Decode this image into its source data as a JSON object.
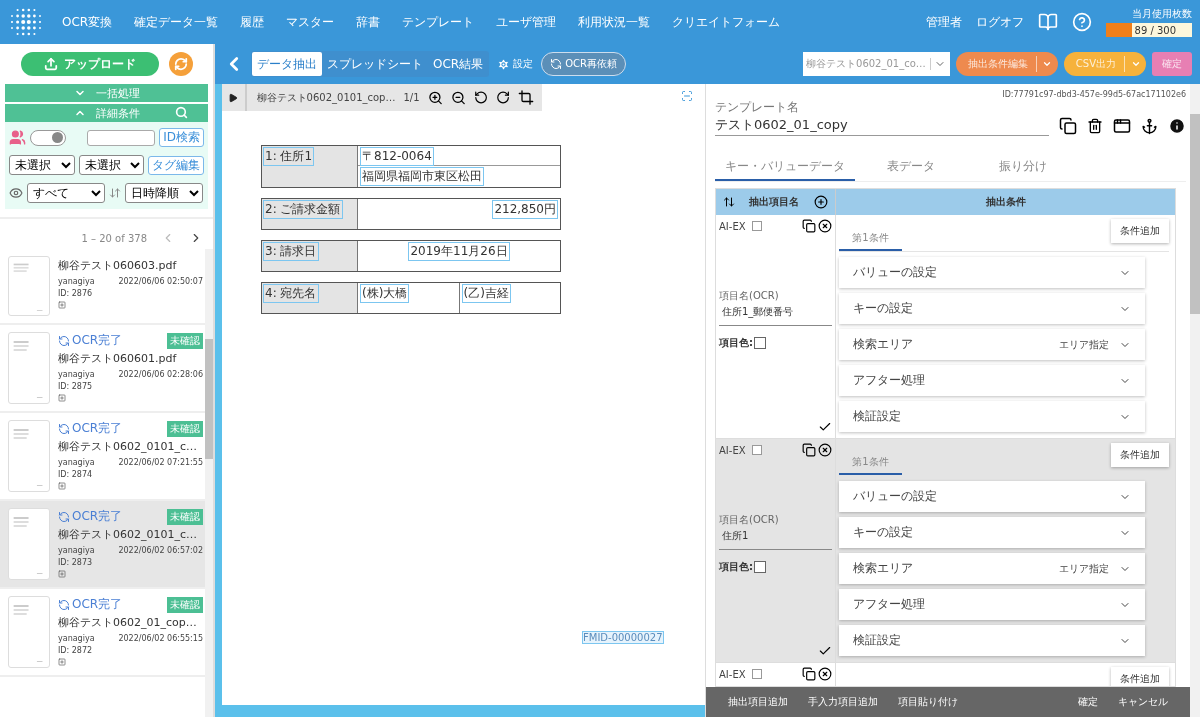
{
  "top_nav": {
    "items": [
      "OCR変換",
      "確定データ一覧",
      "履歴",
      "マスター",
      "辞書",
      "テンプレート",
      "ユーザ管理",
      "利用状況一覧",
      "クリエイトフォーム"
    ],
    "user": "管理者",
    "logout": "ログオフ",
    "usage": {
      "label": "当月使用枚数",
      "reading": "89 / 300",
      "level": 0.297
    }
  },
  "sidebar": {
    "upload": "アップロード",
    "batch": "一括処理",
    "detail": "詳細条件",
    "toggle_on": true,
    "id_search": "ID検索",
    "selects": [
      "未選択",
      "未選択"
    ],
    "tag_edit": "タグ編集",
    "view_select": "すべて",
    "sort_select": "日時降順",
    "pagination": "1 – 20 of 378",
    "files": [
      {
        "name": "柳谷テスト060603.pdf",
        "user": "yanagiya",
        "date": "2022/06/06 02:50:07",
        "id": "ID: 2876",
        "selected": false
      },
      {
        "status": "OCR完了",
        "badge": "未確認",
        "name": "柳谷テスト060601.pdf",
        "user": "yanagiya",
        "date": "2022/06/06 02:28:06",
        "id": "ID: 2875",
        "selected": false
      },
      {
        "status": "OCR完了",
        "badge": "未確認",
        "name": "柳谷テスト0602_0101_c…",
        "user": "yanagiya",
        "date": "2022/06/02 07:21:55",
        "id": "ID: 2874",
        "selected": false
      },
      {
        "status": "OCR完了",
        "badge": "未確認",
        "name": "柳谷テスト0602_0101_c…",
        "user": "yanagiya",
        "date": "2022/06/02 06:57:02",
        "id": "ID: 2873",
        "selected": true
      },
      {
        "status": "OCR完了",
        "badge": "未確認",
        "name": "柳谷テスト0602_01_cop…",
        "user": "yanagiya",
        "date": "2022/06/02 06:55:15",
        "id": "ID: 2872",
        "selected": false
      }
    ]
  },
  "toolbar": {
    "tabs": [
      {
        "label": "データ抽出",
        "selected": true
      },
      {
        "label": "スプレッドシート",
        "selected": false
      },
      {
        "label": "OCR結果",
        "selected": false
      }
    ],
    "settings": "設定",
    "reocr": "OCR再依頼",
    "template_select": "柳谷テスト0602_01_co…",
    "actions": [
      {
        "label": "抽出条件編集",
        "color": "#ee8a4e",
        "split": true
      },
      {
        "label": "CSV出力",
        "color": "#f6b23c",
        "split": true
      },
      {
        "label": "確定",
        "color": "#e77fb3",
        "split": false
      }
    ]
  },
  "viewer": {
    "file_name": "柳谷テスト0602_0101_cop…",
    "page": "1/1",
    "form": [
      {
        "label": "1: 住所1",
        "kind": "stacked",
        "values": [
          "〒812-0064",
          "福岡県福岡市東区松田"
        ]
      },
      {
        "label": "2: ご請求金額",
        "kind": "right",
        "values": [
          "212,850円"
        ]
      },
      {
        "label": "3: 請求日",
        "kind": "center",
        "values": [
          "2019年11月26日"
        ]
      },
      {
        "label": "4: 宛先名",
        "kind": "split",
        "values": [
          "(株)大橋",
          "(乙)吉経"
        ]
      }
    ],
    "fmid": "FMID-00000027"
  },
  "template": {
    "id": "ID:77791c97-dbd3-457e-99d5-67ac171102e6",
    "label": "テンプレート名",
    "name": "テスト0602_01_copy",
    "tabs": [
      {
        "label": "キー・バリューデータ",
        "selected": true
      },
      {
        "label": "表データ",
        "selected": false
      },
      {
        "label": "振り分け",
        "selected": false
      }
    ],
    "columns": [
      "抽出項目名",
      "抽出条件"
    ],
    "fields": [
      {
        "ai_label": "AI-EX",
        "checked": false,
        "ocr_label": "項目名(OCR)",
        "ocr_name": "住所1_郵便番号",
        "color_label": "項目色:",
        "condition_tab": "第1条件",
        "add_button": "条件追加",
        "selected": false,
        "sections": [
          {
            "label": "バリューの設定"
          },
          {
            "label": "キーの設定"
          },
          {
            "label": "検索エリア",
            "value": "エリア指定"
          },
          {
            "label": "アフター処理"
          },
          {
            "label": "検証設定"
          }
        ]
      },
      {
        "ai_label": "AI-EX",
        "checked": false,
        "ocr_label": "項目名(OCR)",
        "ocr_name": "住所1",
        "color_label": "項目色:",
        "condition_tab": "第1条件",
        "add_button": "条件追加",
        "selected": true,
        "sections": [
          {
            "label": "バリューの設定"
          },
          {
            "label": "キーの設定"
          },
          {
            "label": "検索エリア",
            "value": "エリア指定"
          },
          {
            "label": "アフター処理"
          },
          {
            "label": "検証設定"
          }
        ]
      },
      {
        "ai_label": "AI-EX",
        "checked": false,
        "add_button": "条件追加",
        "selected": false
      }
    ],
    "footer_left": [
      "抽出項目追加",
      "手入力項目追加",
      "項目貼り付け"
    ],
    "footer_right": [
      "確定",
      "キャンセル"
    ]
  }
}
